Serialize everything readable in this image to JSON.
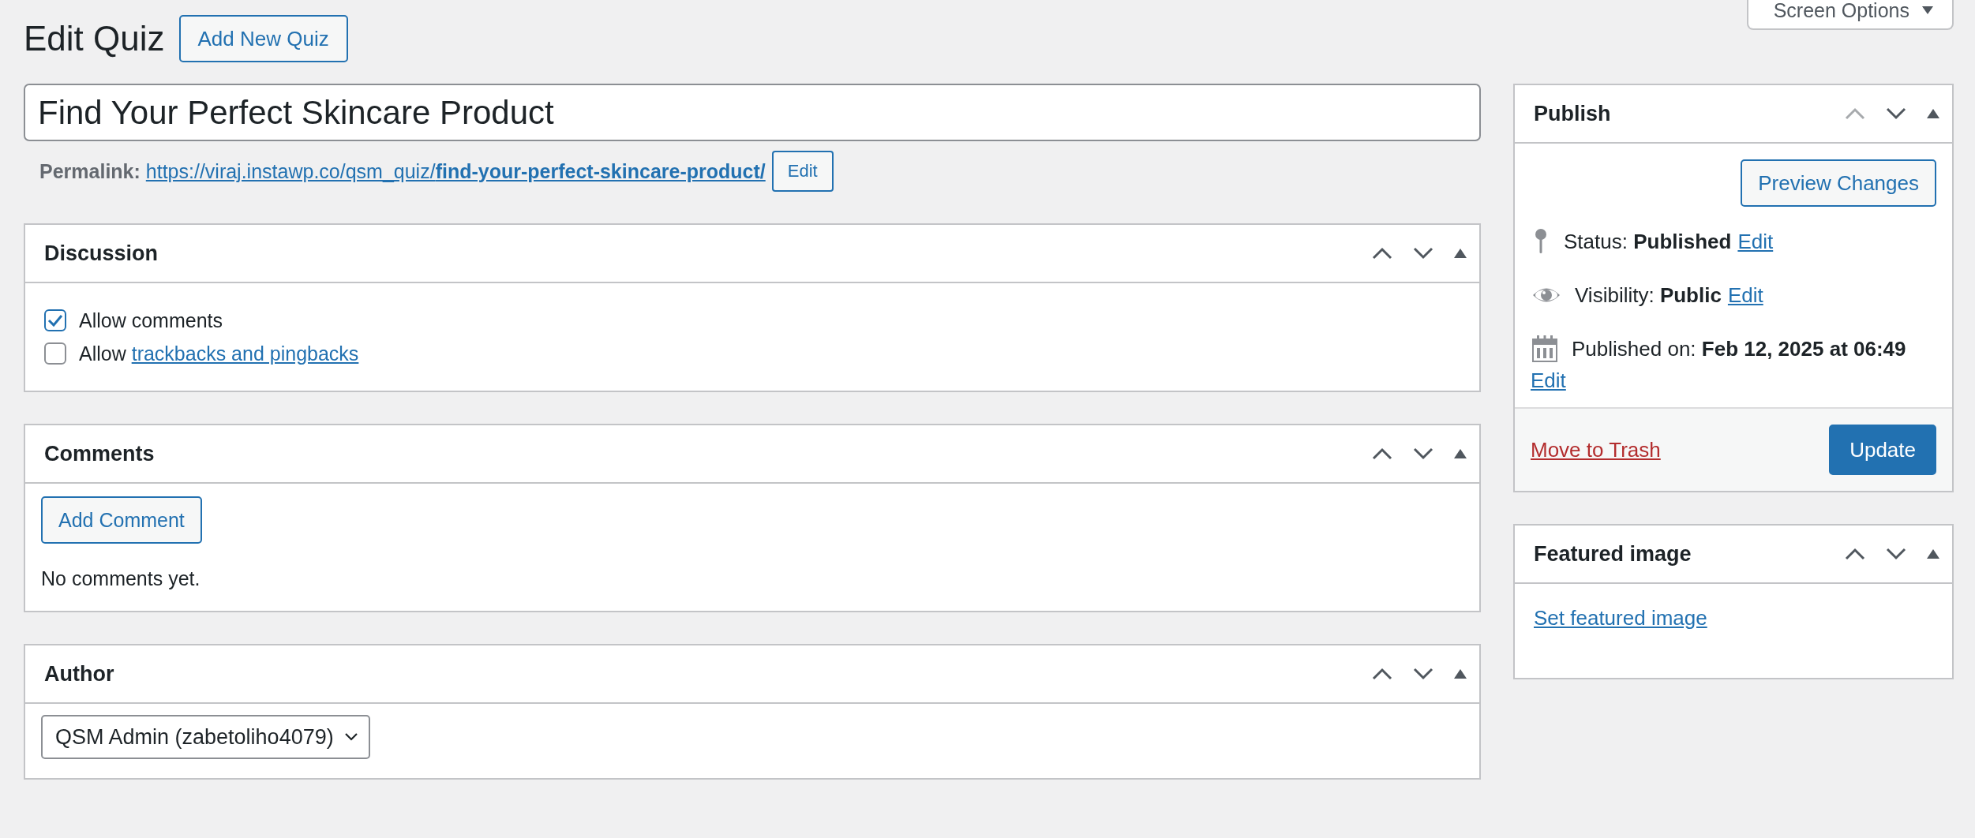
{
  "header": {
    "title": "Edit Quiz",
    "add_new_button": "Add New Quiz",
    "screen_options": "Screen Options"
  },
  "post_title": {
    "value": "Find Your Perfect Skincare Product"
  },
  "permalink": {
    "label": "Permalink:",
    "url": "https://viraj.instawp.co/qsm_quiz/**find-your-perfect-skincare-product/**",
    "edit_button": "Edit"
  },
  "main_panels": [
    {
      "kind": "discussion",
      "title": "Discussion",
      "move_up_disabled": false,
      "options": [
        {
          "text": "Allow comments",
          "checked": true
        },
        {
          "text": "Allow ",
          "link": "trackbacks and pingbacks",
          "checked": false
        }
      ]
    },
    {
      "kind": "comments",
      "title": "Comments",
      "move_up_disabled": false,
      "button": "Add Comment",
      "empty_text": "No comments yet."
    },
    {
      "kind": "author",
      "title": "Author",
      "move_up_disabled": false,
      "select": {
        "value": "QSM Admin (zabetoliho4079)"
      }
    }
  ],
  "sidebar_panels": [
    {
      "kind": "publish",
      "title": "Publish",
      "move_up_disabled": true,
      "preview_button": "Preview Changes",
      "rows": [
        {
          "kind": "status",
          "text": "Status: **Published**",
          "edit": "Edit"
        },
        {
          "kind": "visibility",
          "text": "Visibility: **Public**",
          "edit": "Edit"
        },
        {
          "kind": "date",
          "text": "Published on: **Feb 12, 2025 at 06:49**",
          "edit": "Edit"
        }
      ],
      "trash_link": "Move to Trash",
      "update_button": "Update"
    },
    {
      "kind": "featured_image",
      "title": "Featured image",
      "move_up_disabled": false,
      "link": "Set featured image"
    }
  ]
}
